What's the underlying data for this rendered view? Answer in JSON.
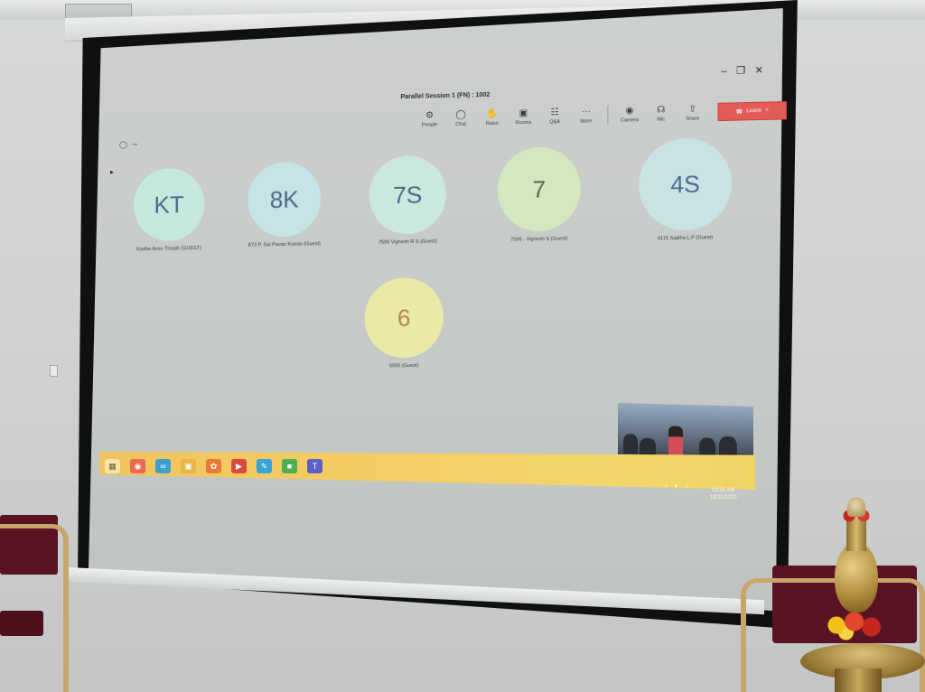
{
  "meeting": {
    "title": "Parallel Session 1 (FN) : 1002",
    "toolbar": [
      {
        "label": "People",
        "icon": "people-icon"
      },
      {
        "label": "Chat",
        "icon": "chat-icon"
      },
      {
        "label": "Raise",
        "icon": "raise-hand-icon"
      },
      {
        "label": "Rooms",
        "icon": "rooms-icon"
      },
      {
        "label": "Q&A",
        "icon": "qa-icon"
      },
      {
        "label": "More",
        "icon": "more-icon"
      }
    ],
    "devices": [
      {
        "label": "Camera",
        "icon": "camera-icon"
      },
      {
        "label": "Mic",
        "icon": "mic-icon"
      },
      {
        "label": "Share",
        "icon": "share-icon"
      }
    ],
    "leave_label": "Leave",
    "leave_color": "#e35b57",
    "participants": [
      {
        "initials": "KT",
        "name": "Kadhe Azes Thoqih (GUEST)",
        "color": "#c6e8dc"
      },
      {
        "initials": "8K",
        "name": "873 P. Sai Pavan Kumar (Guest)",
        "color": "#c6e3e6"
      },
      {
        "initials": "7S",
        "name": "7599 Vignesh R S (Guest)",
        "color": "#cae8dc"
      },
      {
        "initials": "7",
        "name": "7599 - Vignesh S (Guest)",
        "color": "#d3e8c0"
      },
      {
        "initials": "4S",
        "name": "4115 Sajitha.L.P (Guest)",
        "color": "#c9e2e4"
      },
      {
        "initials": "6",
        "name": "6065 (Guest)",
        "color": "#eae9a8"
      }
    ],
    "initials_color": "#4f6a8e",
    "six_color": "#b58a45"
  },
  "taskbar": {
    "icons": [
      "start-icon",
      "chrome-icon",
      "edge-icon",
      "file-explorer-icon",
      "firefox-icon",
      "media-app-icon",
      "paint-app-icon",
      "green-app-icon",
      "teams-icon"
    ],
    "clock_time": "10:31 AM",
    "clock_date": "10/11/2023"
  }
}
